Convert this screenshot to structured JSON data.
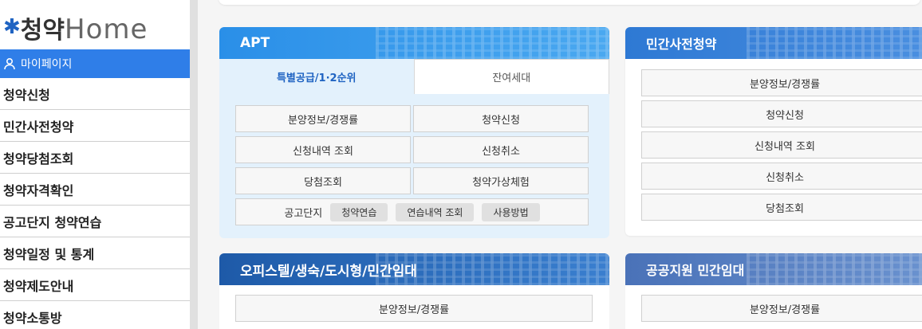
{
  "logo": {
    "ko": "청약",
    "en": "Home"
  },
  "sidebar": {
    "mypage": "마이페이지",
    "items": [
      "청약신청",
      "민간사전청약",
      "청약당첨조회",
      "청약자격확인",
      "공고단지 청약연습",
      "청약일정 및 통계",
      "청약제도안내",
      "청약소통방"
    ]
  },
  "apt": {
    "title": "APT",
    "tabs": [
      "특별공급/1·2순위",
      "잔여세대"
    ],
    "buttons": [
      "분양정보/경쟁률",
      "청약신청",
      "신청내역 조회",
      "신청취소",
      "당첨조회",
      "청약가상체험"
    ],
    "notice": {
      "label": "공고단지",
      "chips": [
        "청약연습",
        "연습내역 조회",
        "사용방법"
      ]
    }
  },
  "pre": {
    "title": "민간사전청약",
    "buttons": [
      "분양정보/경쟁률",
      "청약신청",
      "신청내역 조회",
      "신청취소",
      "당첨조회"
    ]
  },
  "offi": {
    "title": "오피스텔/생숙/도시형/민간임대",
    "buttons": [
      "분양정보/경쟁률"
    ]
  },
  "pub": {
    "title": "공공지원 민간임대",
    "buttons": [
      "분양정보/경쟁률"
    ]
  },
  "colors": {
    "accent": "#2f7ee8",
    "apt_bg": "#e3f1fc",
    "active_tab": "#1f63c2"
  }
}
